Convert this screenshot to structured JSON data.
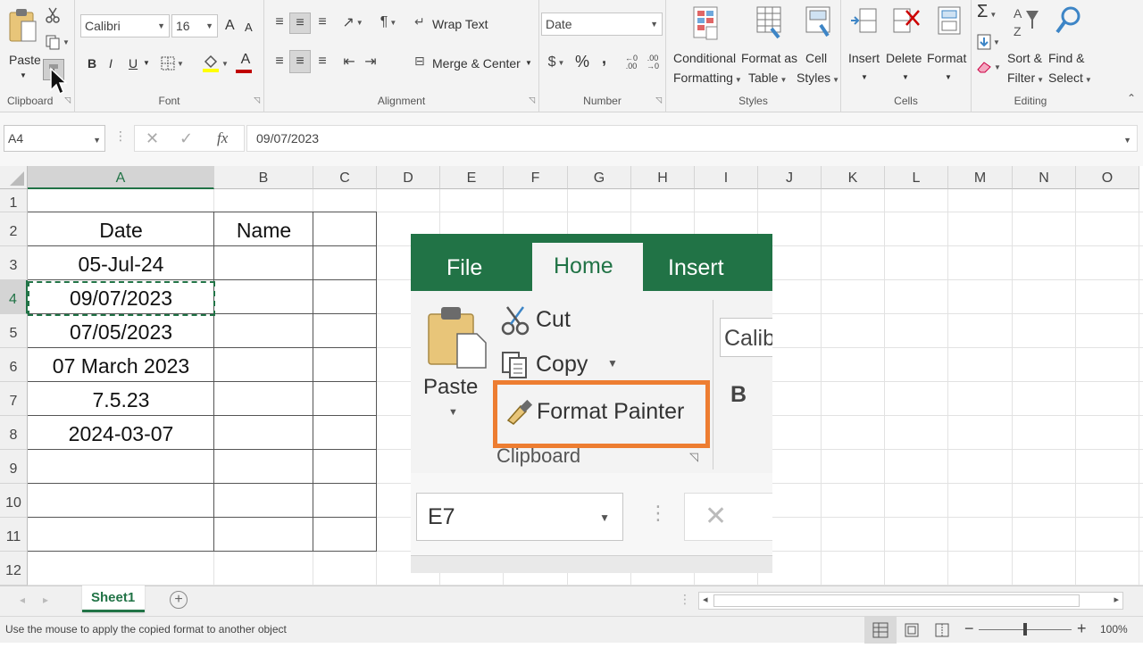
{
  "ribbon": {
    "clipboard": {
      "label": "Clipboard",
      "paste": "Paste"
    },
    "font": {
      "label": "Font",
      "name": "Calibri",
      "size": "16",
      "bold": "B",
      "italic": "I",
      "underline": "U",
      "grow": "A",
      "shrink": "A",
      "font_color_letter": "A"
    },
    "alignment": {
      "label": "Alignment",
      "wrap": "Wrap Text",
      "merge": "Merge & Center"
    },
    "number": {
      "label": "Number",
      "format": "Date",
      "percent": "%",
      "comma": ","
    },
    "styles": {
      "label": "Styles",
      "conditional": [
        "Conditional",
        "Formatting"
      ],
      "table": [
        "Format as",
        "Table"
      ],
      "cell": [
        "Cell",
        "Styles"
      ]
    },
    "cells": {
      "label": "Cells",
      "insert": "Insert",
      "delete": "Delete",
      "format": "Format"
    },
    "editing": {
      "label": "Editing",
      "sort": [
        "Sort &",
        "Filter"
      ],
      "find": [
        "Find &",
        "Select"
      ],
      "sum": "Σ"
    }
  },
  "formula_bar": {
    "name_box": "A4",
    "value": "09/07/2023",
    "fx": "fx"
  },
  "columns": [
    "A",
    "B",
    "C",
    "D",
    "E",
    "F",
    "G",
    "H",
    "I",
    "J",
    "K",
    "L",
    "M",
    "N",
    "O"
  ],
  "rows": [
    "1",
    "2",
    "3",
    "4",
    "5",
    "6",
    "7",
    "8",
    "9",
    "10",
    "11",
    "12"
  ],
  "table": {
    "headers": [
      "Date",
      "Name"
    ],
    "dates": [
      "05-Jul-24",
      "09/07/2023",
      "07/05/2023",
      "07 March 2023",
      "7.5.23",
      "2024-03-07"
    ]
  },
  "inset": {
    "tabs": [
      "File",
      "Home",
      "Insert"
    ],
    "paste": "Paste",
    "cut": "Cut",
    "copy": "Copy",
    "format_painter": "Format Painter",
    "group": "Clipboard",
    "font_partial": "Calib",
    "bold": "B",
    "name_box": "E7",
    "accent": "#217346",
    "highlight": "#ed7d31"
  },
  "sheet": {
    "tab": "Sheet1"
  },
  "status": {
    "message": "Use the mouse to apply the copied format to another object",
    "zoom": "100%"
  }
}
